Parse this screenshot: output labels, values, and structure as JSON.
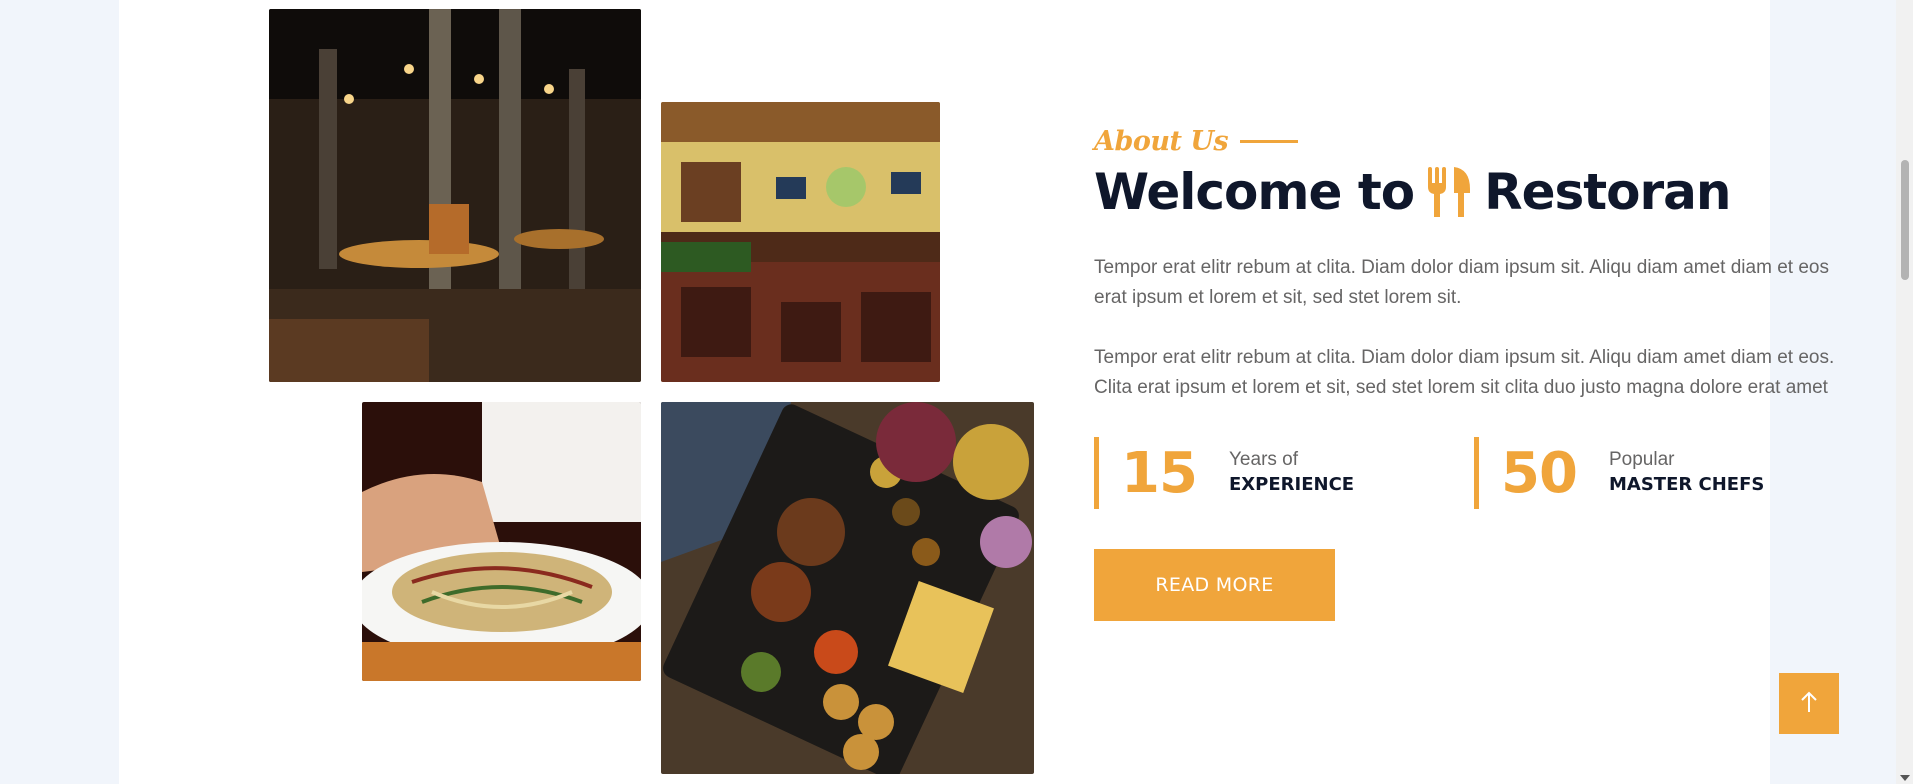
{
  "about": {
    "subtitle": "About Us",
    "heading_prefix": "Welcome to",
    "heading_brand": "Restoran",
    "paragraph_1": "Tempor erat elitr rebum at clita. Diam dolor diam ipsum sit. Aliqu diam amet diam et eos erat ipsum et lorem et sit, sed stet lorem sit.",
    "paragraph_2": "Tempor erat elitr rebum at clita. Diam dolor diam ipsum sit. Aliqu diam amet diam et eos. Clita erat ipsum et lorem et sit, sed stet lorem sit clita duo justo magna dolore erat amet",
    "stats": [
      {
        "number": "15",
        "line1": "Years of",
        "line2": "EXPERIENCE"
      },
      {
        "number": "50",
        "line1": "Popular",
        "line2": "MASTER CHEFS"
      }
    ],
    "button_label": "READ MORE"
  },
  "icons": {
    "brand": "utensils-icon",
    "back_to_top": "arrow-up-icon"
  },
  "colors": {
    "accent": "#f0a53b",
    "dark": "#0f172b",
    "body_text": "#666565",
    "page_bg": "#f1f5fb"
  }
}
